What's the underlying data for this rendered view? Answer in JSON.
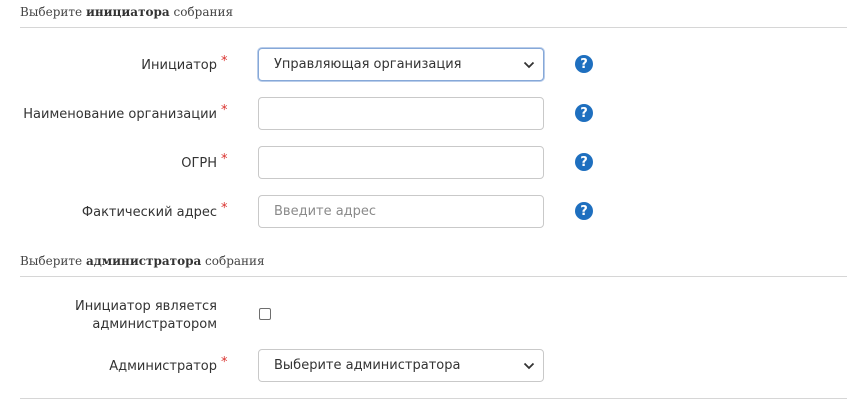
{
  "section_initiator": {
    "prefix": "Выберите ",
    "bold": "инициатора",
    "suffix": " собрания"
  },
  "section_admin": {
    "prefix": "Выберите ",
    "bold": "администратора",
    "suffix": " собрания"
  },
  "required_mark": "*",
  "help_glyph": "?",
  "fields": {
    "initiator": {
      "label": "Инициатор",
      "value": "Управляющая организация"
    },
    "org_name": {
      "label": "Наименование организации",
      "value": ""
    },
    "ogrn": {
      "label": "ОГРН",
      "value": ""
    },
    "address": {
      "label": "Фактический адрес",
      "placeholder": "Введите адрес"
    },
    "initiator_is_admin": {
      "label": "Инициатор является администратором",
      "checked": false
    },
    "administrator": {
      "label": "Администратор",
      "value": "Выберите администратора"
    }
  },
  "colors": {
    "required": "#d9302c",
    "help_icon": "#1e6fbf",
    "focus_border": "#86a8d8"
  }
}
